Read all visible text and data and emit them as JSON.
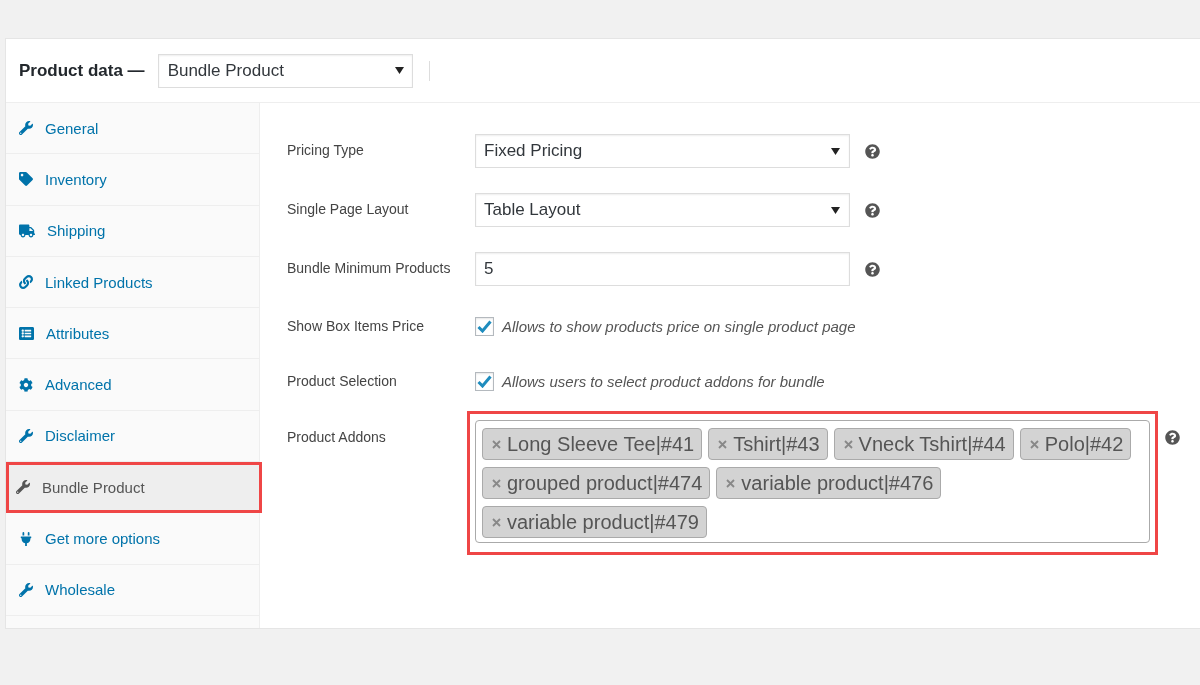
{
  "header": {
    "title": "Product data —",
    "product_type": "Bundle Product"
  },
  "sidebar": {
    "items": [
      {
        "label": "General",
        "kind": "wrench",
        "selected": false,
        "highlighted": false
      },
      {
        "label": "Inventory",
        "kind": "tag",
        "selected": false,
        "highlighted": false
      },
      {
        "label": "Shipping",
        "kind": "truck",
        "selected": false,
        "highlighted": false
      },
      {
        "label": "Linked Products",
        "kind": "link",
        "selected": false,
        "highlighted": false
      },
      {
        "label": "Attributes",
        "kind": "list",
        "selected": false,
        "highlighted": false
      },
      {
        "label": "Advanced",
        "kind": "gear",
        "selected": false,
        "highlighted": false
      },
      {
        "label": "Disclaimer",
        "kind": "wrench",
        "selected": false,
        "highlighted": false
      },
      {
        "label": "Bundle Product",
        "kind": "wrench",
        "selected": true,
        "highlighted": true
      },
      {
        "label": "Get more options",
        "kind": "plug",
        "selected": false,
        "highlighted": false
      },
      {
        "label": "Wholesale",
        "kind": "wrench",
        "selected": false,
        "highlighted": false
      }
    ]
  },
  "fields": [
    {
      "kind": "select",
      "label": "Pricing Type",
      "value": "Fixed Pricing",
      "help": true
    },
    {
      "kind": "select",
      "label": "Single Page Layout",
      "value": "Table Layout",
      "help": true
    },
    {
      "kind": "text",
      "label": "Bundle Minimum Products",
      "value": "5",
      "help": true
    },
    {
      "kind": "checkbox",
      "label": "Show Box Items Price",
      "checked": true,
      "description": "Allows to show products price on single product page"
    },
    {
      "kind": "checkbox",
      "label": "Product Selection",
      "checked": true,
      "description": "Allows users to select product addons for bundle"
    },
    {
      "kind": "tags",
      "label": "Product Addons",
      "help": true,
      "highlighted": true,
      "tags": [
        {
          "label": "Long Sleeve Tee|#41"
        },
        {
          "label": "Tshirt|#43"
        },
        {
          "label": "Vneck Tshirt|#44"
        },
        {
          "label": "Polo|#42"
        },
        {
          "label": "grouped product|#474"
        },
        {
          "label": "variable product|#476"
        },
        {
          "label": "variable product|#479"
        }
      ]
    }
  ]
}
